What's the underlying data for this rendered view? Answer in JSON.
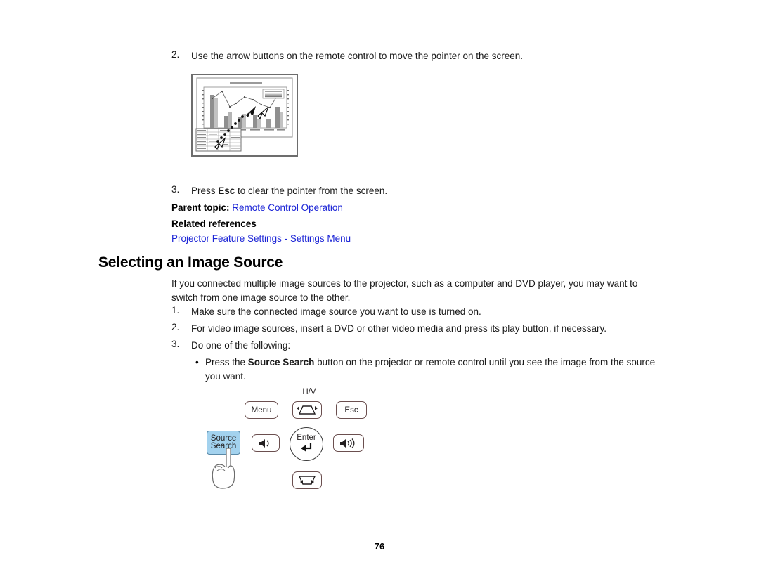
{
  "document": {
    "page_number": "76"
  },
  "steps_pointer": {
    "step2": {
      "marker": "2.",
      "text": "Use the arrow buttons on the remote control to move the pointer on the screen."
    },
    "step3": {
      "marker": "3.",
      "text_before": "Press ",
      "bold": "Esc",
      "text_after": " to clear the pointer from the screen."
    }
  },
  "pointer_figure": {
    "alt": "projected slide with chart and pointer arrow",
    "icon": "projection-screen-icon"
  },
  "parent_topic": {
    "label": "Parent topic:",
    "link": "Remote Control Operation"
  },
  "related_references": {
    "label": "Related references",
    "link": "Projector Feature Settings - Settings Menu"
  },
  "section": {
    "heading": "Selecting an Image Source",
    "intro": "If you connected multiple image sources to the projector, such as a computer and DVD player, you may want to switch from one image source to the other.",
    "steps": [
      {
        "marker": "1.",
        "text": "Make sure the connected image source you want to use is turned on."
      },
      {
        "marker": "2.",
        "text": "For video image sources, insert a DVD or other video media and press its play button, if necessary."
      },
      {
        "marker": "3.",
        "text": "Do one of the following:"
      }
    ],
    "bullet": {
      "marker": "•",
      "text_before": "Press the ",
      "bold": "Source Search",
      "text_after": " button on the projector or remote control until you see the image from the source you want."
    }
  },
  "control_panel": {
    "hv_label": "H/V",
    "buttons": [
      {
        "name": "menu-button",
        "label": "Menu",
        "icon": "",
        "highlighted": false
      },
      {
        "name": "keystone-hv-button",
        "label": "",
        "icon": "keystone-up-icon",
        "highlighted": false
      },
      {
        "name": "esc-button",
        "label": "Esc",
        "icon": "",
        "highlighted": false
      },
      {
        "name": "source-search-button",
        "label": "Source\nSearch",
        "icon": "",
        "highlighted": true
      },
      {
        "name": "volume-down-button",
        "label": "",
        "icon": "speaker-low-icon",
        "highlighted": false
      },
      {
        "name": "enter-button",
        "label": "Enter",
        "icon": "enter-arrow-icon",
        "highlighted": false
      },
      {
        "name": "volume-up-button",
        "label": "",
        "icon": "speaker-high-icon",
        "highlighted": false
      },
      {
        "name": "keystone-down-button",
        "label": "",
        "icon": "keystone-down-icon",
        "highlighted": false
      }
    ],
    "source_search_label_line1": "Source",
    "source_search_label_line2": "Search",
    "enter_label": "Enter",
    "menu_label": "Menu",
    "esc_label": "Esc",
    "hand_icon": "pointing-hand-icon"
  },
  "colors": {
    "link": "#1b24d6",
    "highlight": "#a3d2ee",
    "button_outline": "#6b4f4f",
    "text": "#1a1a1a"
  }
}
